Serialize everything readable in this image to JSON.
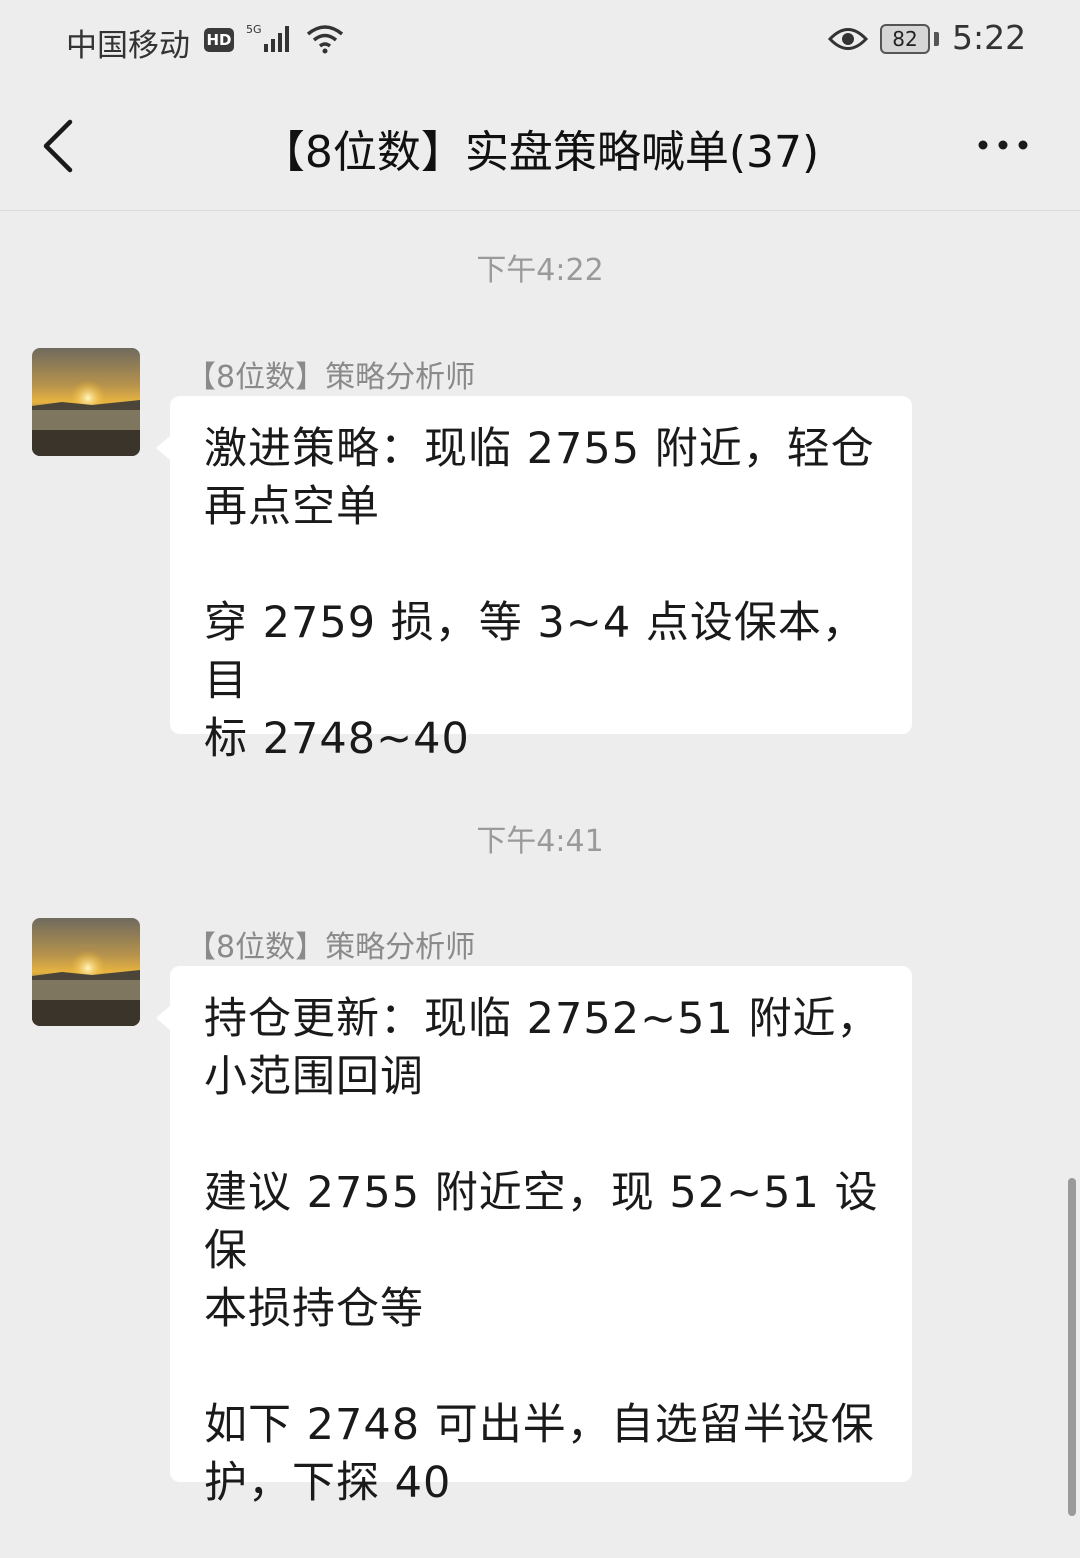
{
  "status_bar": {
    "carrier": "中国移动",
    "hd": "HD",
    "network": "5G",
    "battery": "82",
    "time": "5:22"
  },
  "header": {
    "title": "【8位数】实盘策略喊单(37)",
    "back_icon": "chevron-left-icon",
    "more_icon": "more-dots-icon"
  },
  "messages": [
    {
      "timestamp": "下午4:22",
      "sender": "【8位数】策略分析师",
      "paragraphs": [
        [
          "激进策略：现临 2755 附近，轻仓",
          "再点空单"
        ],
        [
          "穿 2759 损，等 3~4 点设保本，目",
          "标 2748~40"
        ]
      ]
    },
    {
      "timestamp": "下午4:41",
      "sender": "【8位数】策略分析师",
      "paragraphs": [
        [
          "持仓更新：现临 2752~51 附近，",
          "小范围回调"
        ],
        [
          "建议 2755 附近空，现 52~51 设保",
          "本损持仓等"
        ],
        [
          "如下 2748 可出半，自选留半设保",
          "护，下探 40"
        ]
      ]
    }
  ]
}
